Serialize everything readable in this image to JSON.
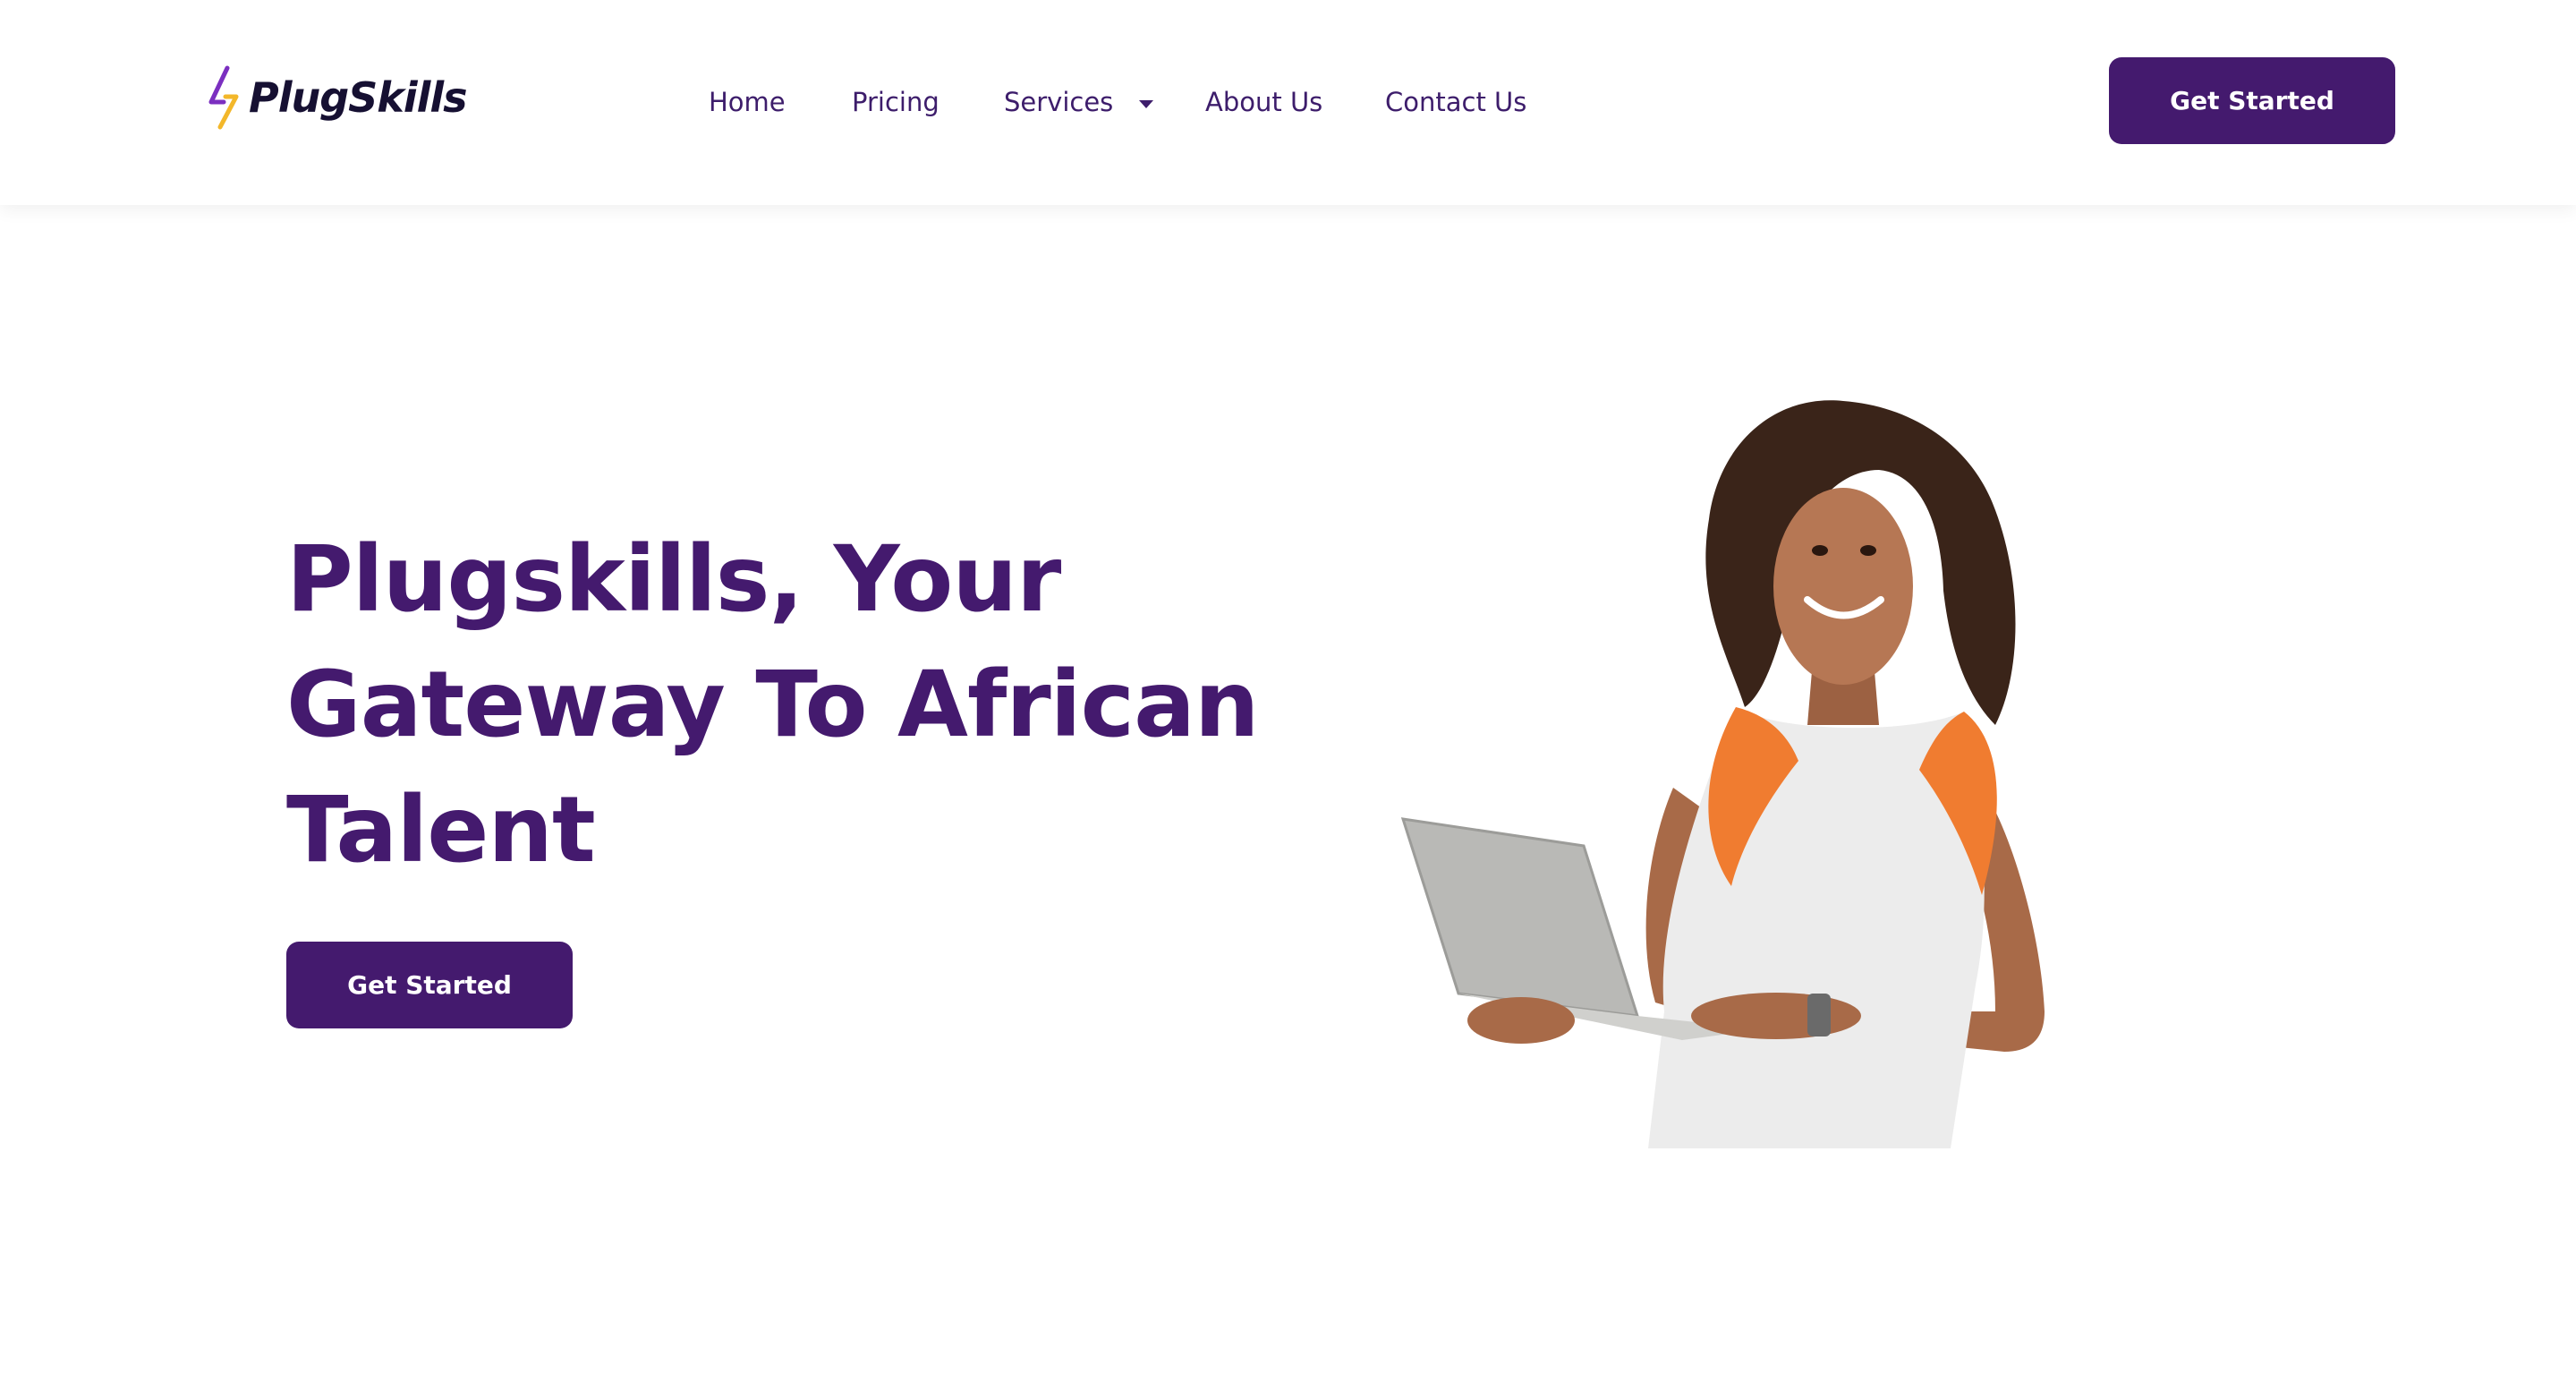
{
  "brand": {
    "name": "PlugSkills",
    "primary_color": "#441a6e",
    "logo_accent_purple": "#7b2fc0",
    "logo_accent_yellow": "#f3b72a"
  },
  "nav": {
    "items": [
      {
        "label": "Home"
      },
      {
        "label": "Pricing"
      },
      {
        "label": "Services",
        "has_dropdown": true
      },
      {
        "label": "About Us"
      },
      {
        "label": "Contact Us"
      }
    ],
    "dropdown_icon": "caret-down-icon"
  },
  "header": {
    "cta_label": "Get Started"
  },
  "hero": {
    "title": "Plugskills, Your Gateway To African Talent",
    "cta_label": "Get Started",
    "image_alt": "Woman holding a laptop"
  }
}
